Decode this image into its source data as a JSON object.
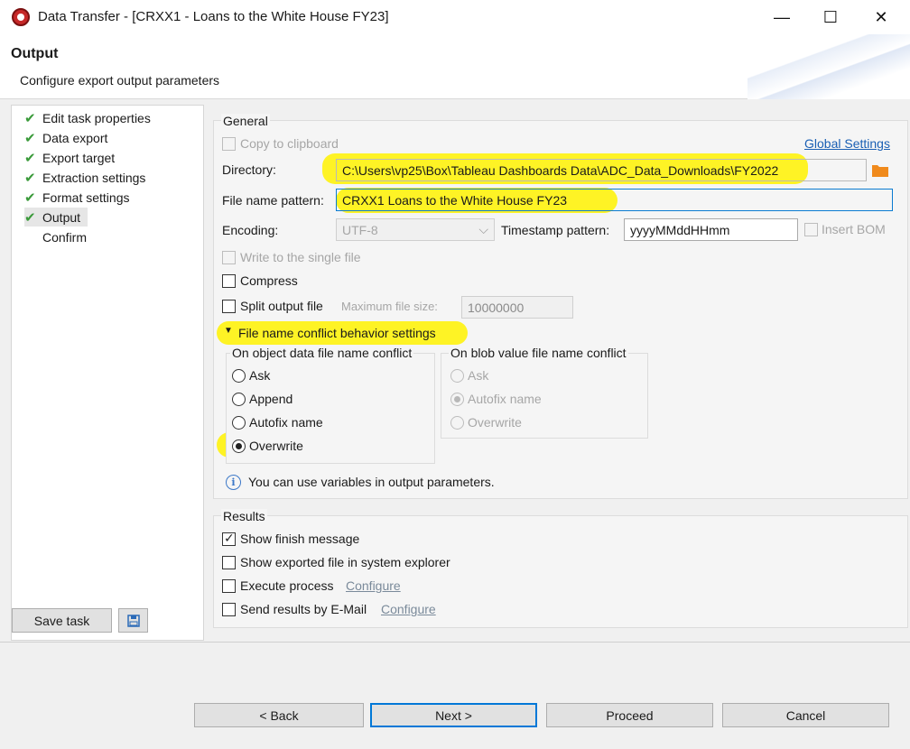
{
  "window": {
    "title": "Data Transfer - [CRXX1 - Loans to the White House FY23]",
    "controls": {
      "minimize": "—",
      "maximize": "☐",
      "close": "✕"
    }
  },
  "header": {
    "title": "Output",
    "subtitle": "Configure export output parameters"
  },
  "nav": {
    "items": [
      {
        "label": "Edit task properties",
        "done": true
      },
      {
        "label": "Data export",
        "done": true
      },
      {
        "label": "Export target",
        "done": true
      },
      {
        "label": "Extraction settings",
        "done": true
      },
      {
        "label": "Format settings",
        "done": true
      },
      {
        "label": "Output",
        "done": true,
        "selected": true
      },
      {
        "label": "Confirm",
        "done": false
      }
    ],
    "check_glyph": "✔",
    "save_task_label": "Save task",
    "save_icon": "floppy-disk-icon"
  },
  "general": {
    "legend": "General",
    "copy_to_clipboard": {
      "label": "Copy to clipboard",
      "checked": false,
      "disabled": true
    },
    "global_settings_link": "Global Settings",
    "directory": {
      "label": "Directory:",
      "value": "C:\\Users\\vp25\\Box\\Tableau Dashboards Data\\ADC_Data_Downloads\\FY2022"
    },
    "file_name_pattern": {
      "label": "File name pattern:",
      "value": "CRXX1 Loans to the White House FY23"
    },
    "encoding": {
      "label": "Encoding:",
      "value": "UTF-8"
    },
    "timestamp_pattern": {
      "label": "Timestamp pattern:",
      "value": "yyyyMMddHHmm"
    },
    "insert_bom": {
      "label": "Insert BOM",
      "checked": false,
      "disabled": true
    },
    "write_single_file": {
      "label": "Write to the single file",
      "checked": false,
      "disabled": true
    },
    "compress": {
      "label": "Compress",
      "checked": false
    },
    "split_output": {
      "label": "Split output file",
      "checked": false
    },
    "max_file_size": {
      "label": "Maximum file size:",
      "value": "10000000"
    },
    "conflict_section": {
      "label": "File name conflict behavior settings",
      "expanded": true
    },
    "object_conflict": {
      "legend": "On object data file name conflict",
      "options": [
        "Ask",
        "Append",
        "Autofix name",
        "Overwrite"
      ],
      "selected": "Overwrite"
    },
    "blob_conflict": {
      "legend": "On blob value file name conflict",
      "options": [
        "Ask",
        "Autofix name",
        "Overwrite"
      ],
      "selected": "Autofix name",
      "disabled": true
    },
    "info_text": "You can use variables in output parameters."
  },
  "results": {
    "legend": "Results",
    "show_finish_message": {
      "label": "Show finish message",
      "checked": true
    },
    "show_in_explorer": {
      "label": "Show exported file in system explorer",
      "checked": false
    },
    "execute_process": {
      "label": "Execute process",
      "checked": false,
      "configure": "Configure"
    },
    "send_email": {
      "label": "Send results by E-Mail",
      "checked": false,
      "configure": "Configure"
    }
  },
  "buttons": {
    "back": "< Back",
    "next": "Next >",
    "proceed": "Proceed",
    "cancel": "Cancel"
  },
  "colors": {
    "highlight": "#fff200",
    "check_green": "#3a9a3a",
    "link_blue": "#1a5fb4",
    "focus_blue": "#0078d7"
  }
}
